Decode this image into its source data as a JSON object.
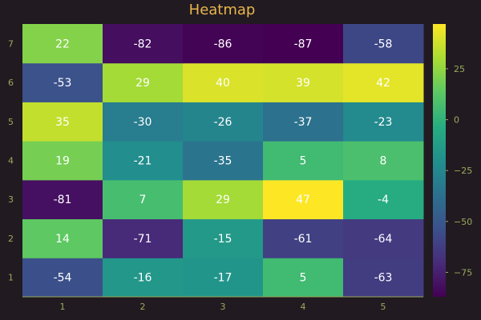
{
  "chart_data": {
    "type": "heatmap",
    "title": "Heatmap",
    "x": [
      "1",
      "2",
      "3",
      "4",
      "5"
    ],
    "y": [
      "1",
      "2",
      "3",
      "4",
      "5",
      "6",
      "7"
    ],
    "values": [
      [
        -54,
        -16,
        -17,
        5,
        -63
      ],
      [
        14,
        -71,
        -15,
        -61,
        -64
      ],
      [
        -81,
        7,
        29,
        47,
        -4
      ],
      [
        19,
        -21,
        -35,
        5,
        8
      ],
      [
        35,
        -30,
        -26,
        -37,
        -23
      ],
      [
        -53,
        29,
        40,
        39,
        42
      ],
      [
        22,
        -82,
        -86,
        -87,
        -58
      ]
    ],
    "colorscale": "viridis",
    "color_range": [
      -87,
      47
    ],
    "colorbar_ticks": [
      -75,
      -50,
      -25,
      0,
      25
    ],
    "colors": {
      "background": "#211a21",
      "title": "#e8b64b",
      "tick_labels": "#9bac5b",
      "axis_line": "#9bac5b",
      "cell_text": "#ffffff"
    }
  }
}
